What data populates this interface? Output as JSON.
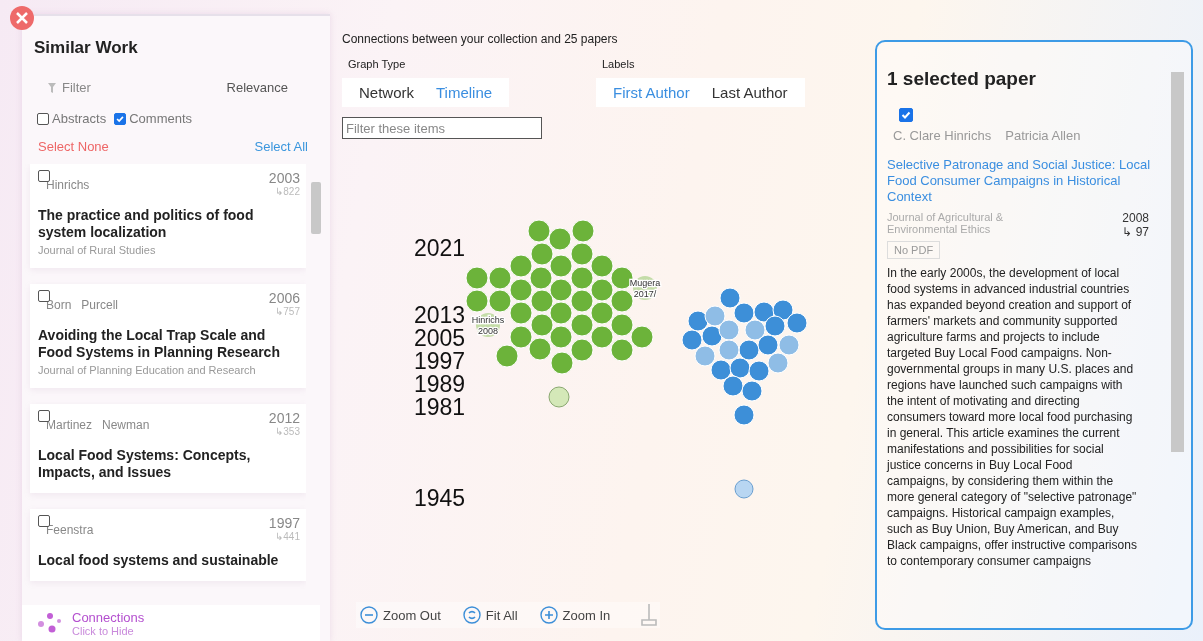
{
  "similar_work": {
    "title": "Similar Work",
    "filter": {
      "placeholder": "Filter"
    },
    "sort": "Relevance",
    "options": [
      {
        "label": "Abstracts",
        "checked": false
      },
      {
        "label": "Comments",
        "checked": true
      }
    ],
    "select_none": "Select None",
    "select_all": "Select All",
    "papers": [
      {
        "checked": false,
        "authors": [
          "Hinrichs"
        ],
        "year": "2003",
        "citations": "↳822",
        "title": "The practice and politics of food system localization",
        "journal": "Journal of Rural Studies"
      },
      {
        "checked": false,
        "authors": [
          "Born",
          "Purcell"
        ],
        "year": "2006",
        "citations": "↳757",
        "title": "Avoiding the Local Trap Scale and Food Systems in Planning Research",
        "journal": "Journal of Planning Education and Research"
      },
      {
        "checked": false,
        "authors": [
          "Martinez",
          "Newman"
        ],
        "year": "2012",
        "citations": "↳353",
        "title": "Local Food Systems: Concepts, Impacts, and Issues"
      },
      {
        "checked": false,
        "authors": [
          "Feenstra"
        ],
        "year": "1997",
        "citations": "↳441",
        "title": "Local food systems and sustainable"
      }
    ],
    "connections": {
      "title": "Connections",
      "subtitle": "Click to Hide"
    }
  },
  "graph": {
    "heading": "Connections between your collection and 25 papers",
    "graph_type": {
      "label": "Graph Type",
      "options": [
        {
          "label": "Network",
          "selected": false
        },
        {
          "label": "Timeline",
          "selected": true
        }
      ]
    },
    "labels": {
      "label": "Labels",
      "options": [
        {
          "label": "First Author",
          "selected": true
        },
        {
          "label": "Last Author",
          "selected": false
        }
      ]
    },
    "filter": {
      "placeholder": "Filter these items"
    },
    "years": [
      "2021",
      "2013",
      "2005",
      "1997",
      "1989",
      "1981",
      "1945"
    ],
    "node_labels": [
      {
        "name": "Hinrichs",
        "year": "2008"
      },
      {
        "name": "Mugera",
        "year": "2017/"
      }
    ],
    "toolbar": [
      "Zoom Out",
      "Fit All",
      "Zoom In"
    ]
  },
  "selected": {
    "title": "1 selected paper",
    "checked": true,
    "authors": [
      "C. Clare Hinrichs",
      "Patricia Allen"
    ],
    "paper_title": "Selective Patronage and Social Justice: Local Food Consumer Campaigns in Historical Context",
    "journal": "Journal of Agricultural & Environmental Ethics",
    "year": "2008",
    "citations": "↳ 97",
    "pdf": "No PDF",
    "abstract": "In the early 2000s, the development of local food systems in advanced industrial countries has expanded beyond creation and support of farmers' markets and community supported agriculture farms and projects to include targeted Buy Local Food campaigns. Non-governmental groups in many U.S. places and regions have launched such campaigns with the intent of motivating and directing consumers toward more local food purchasing in general. This article examines the current manifestations and possibilities for social justice concerns in Buy Local Food campaigns, by considering them within the more general category of \"selective patronage\" campaigns. Historical campaign examples, such as Buy Union, Buy American, and Buy Black campaigns, offer instructive comparisons to contemporary consumer campaigns"
  }
}
